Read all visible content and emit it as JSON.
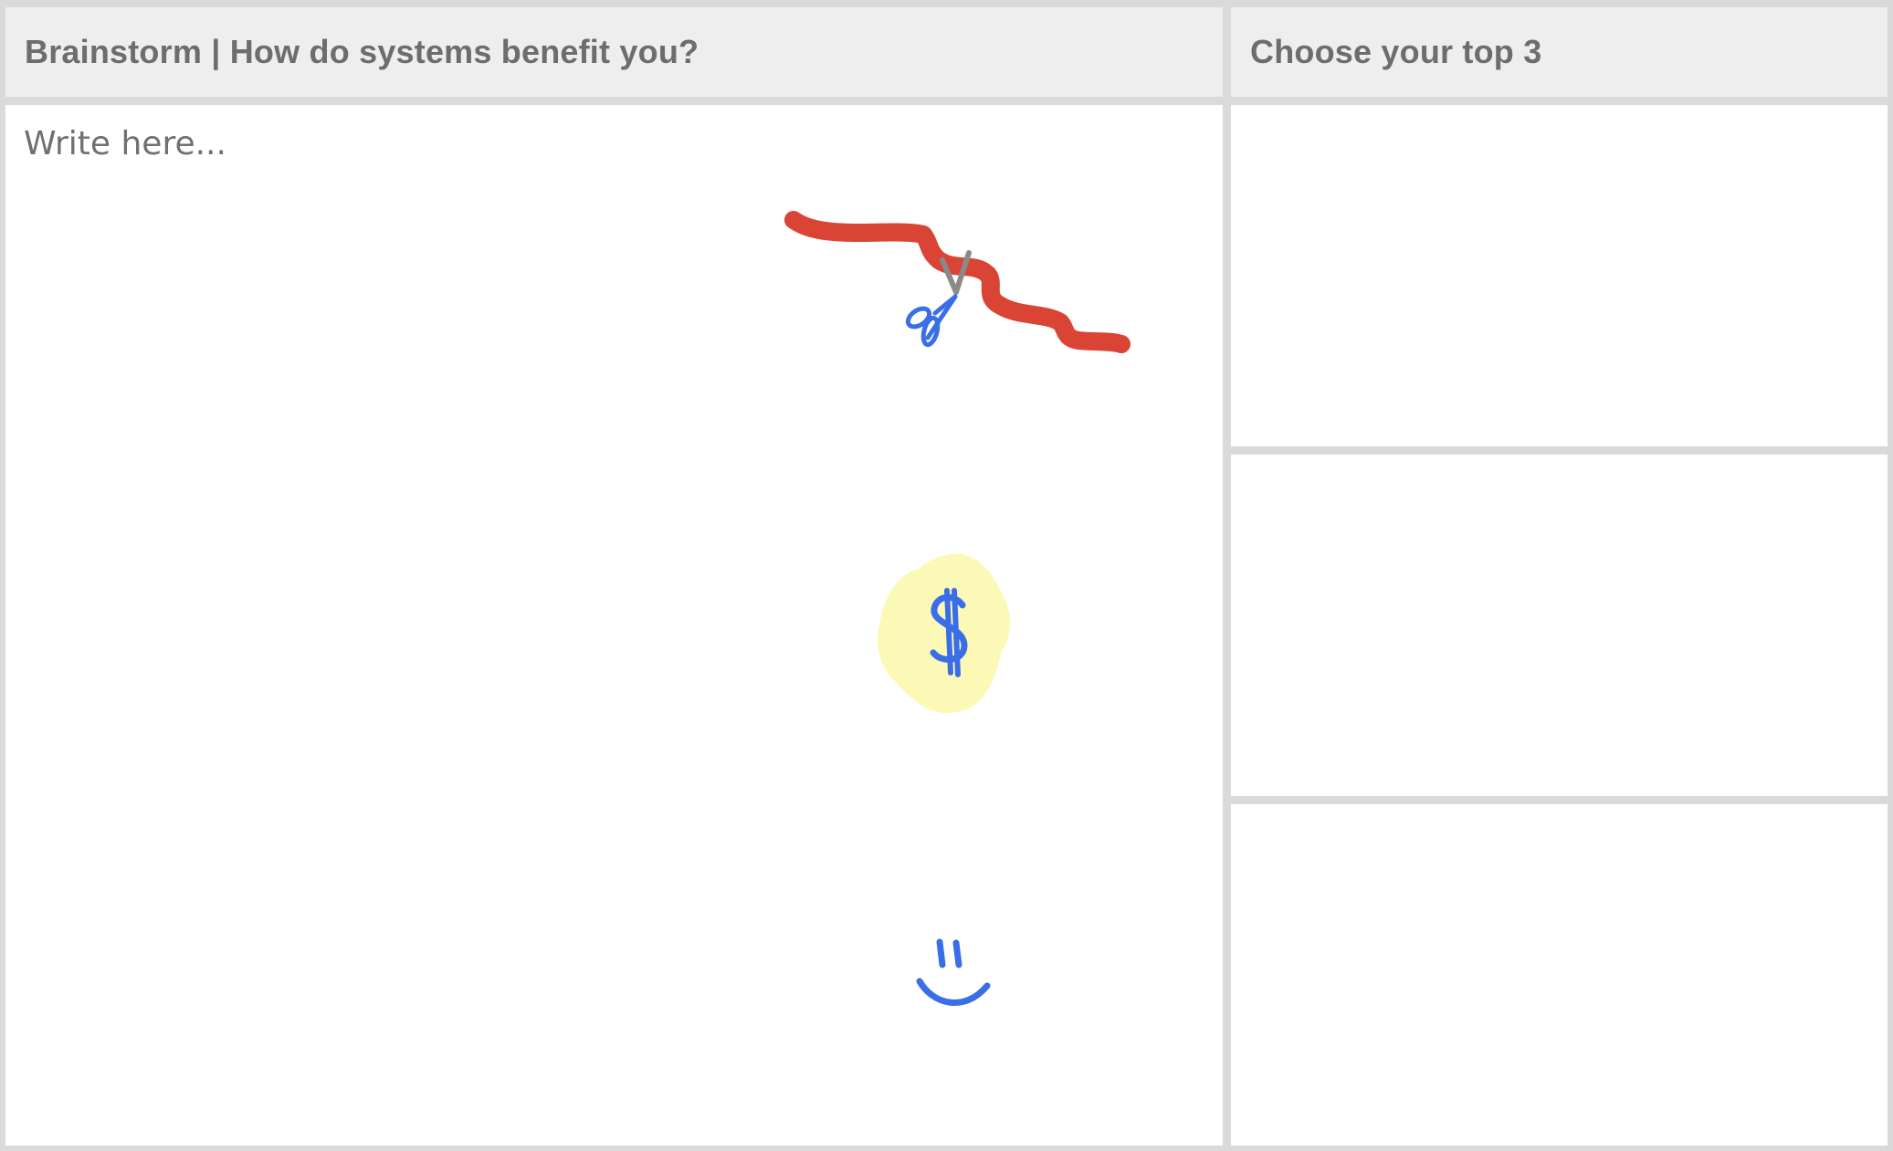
{
  "brainstorm": {
    "title": "Brainstorm | How do systems benefit you?",
    "placeholder": "Write here..."
  },
  "top_choices": {
    "title": "Choose your top 3",
    "slots": [
      "",
      "",
      ""
    ]
  },
  "drawings": {
    "ribbon_color": "#d94434",
    "ink_color": "#3a6ee8",
    "highlight_color": "#fcf9b6",
    "scissors_blade_color": "#8a8a8a",
    "items": [
      {
        "name": "red-tape-with-scissors",
        "icon": "scissors-icon"
      },
      {
        "name": "money",
        "icon": "dollar-icon"
      },
      {
        "name": "smiley",
        "icon": "smiley-icon"
      }
    ]
  }
}
